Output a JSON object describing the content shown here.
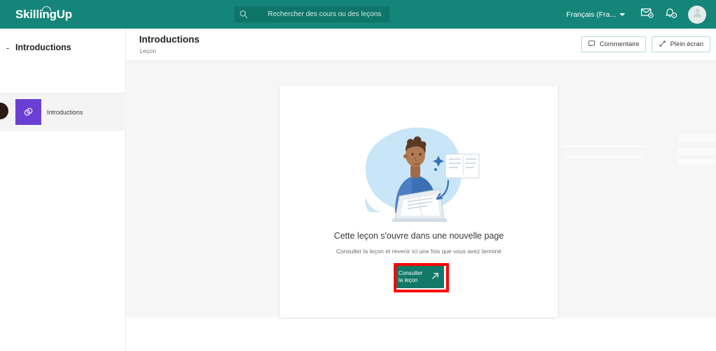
{
  "brand": {
    "name": "SkillingUp",
    "header_color": "#158579",
    "search_bg": "#0e7669",
    "accent": "#127868",
    "highlight_color": "#ff0000",
    "thumb_color": "#6b3fd4"
  },
  "topbar": {
    "search": {
      "placeholder": "Rechercher des cours ou des leçons",
      "value": "",
      "icon": "search-icon"
    },
    "language": {
      "label": "Français (Fra...",
      "icon": "chevron-down-icon"
    },
    "messages_icon": "envelope-icon",
    "notifications_icon": "bell-icon",
    "avatar_icon": "user-avatar-icon"
  },
  "sidebar": {
    "collapse_label": "-",
    "title": "Introductions",
    "items": [
      {
        "label": "Introductions",
        "thumb_icon": "link-icon",
        "selected": true
      }
    ]
  },
  "page": {
    "title": "Introductions",
    "subtitle": "Leçon",
    "actions": [
      {
        "label": "Commentaire",
        "icon": "comment-icon"
      },
      {
        "label": "Plein écran",
        "icon": "fullscreen-icon"
      }
    ]
  },
  "card": {
    "illustration": "person-at-laptop-illustration",
    "message_main": "Cette leçon s'ouvre dans une nouvelle page",
    "message_sub": "Consulter la leçon et revenir ici une fois que vous avez terminé",
    "cta": {
      "label": "Consulter la leçon",
      "icon": "external-link-arrow-icon"
    }
  }
}
